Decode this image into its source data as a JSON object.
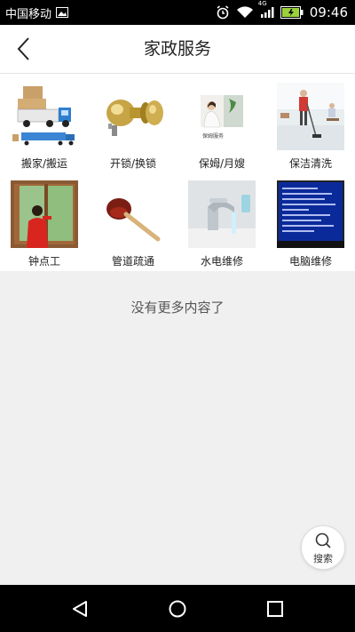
{
  "status_bar": {
    "carrier": "中国移动",
    "network": "4G",
    "time": "09:46"
  },
  "header": {
    "title": "家政服务"
  },
  "services": [
    {
      "label": "搬家/搬运",
      "icon": "moving-truck-image"
    },
    {
      "label": "开锁/换锁",
      "icon": "door-lock-image"
    },
    {
      "label": "保姆/月嫂",
      "icon": "nanny-image"
    },
    {
      "label": "保洁清洗",
      "icon": "cleaning-image"
    },
    {
      "label": "钟点工",
      "icon": "hourly-worker-image"
    },
    {
      "label": "管道疏通",
      "icon": "plunger-image"
    },
    {
      "label": "水电维修",
      "icon": "faucet-image"
    },
    {
      "label": "电脑维修",
      "icon": "computer-screen-image"
    }
  ],
  "nanny_sign_text": "保姆服务",
  "footer": {
    "no_more": "没有更多内容了"
  },
  "search_fab": {
    "label": "搜索"
  },
  "colors": {
    "status_bar_bg": "#000000",
    "header_bg": "#ffffff",
    "page_bg": "#f0f0f0"
  }
}
